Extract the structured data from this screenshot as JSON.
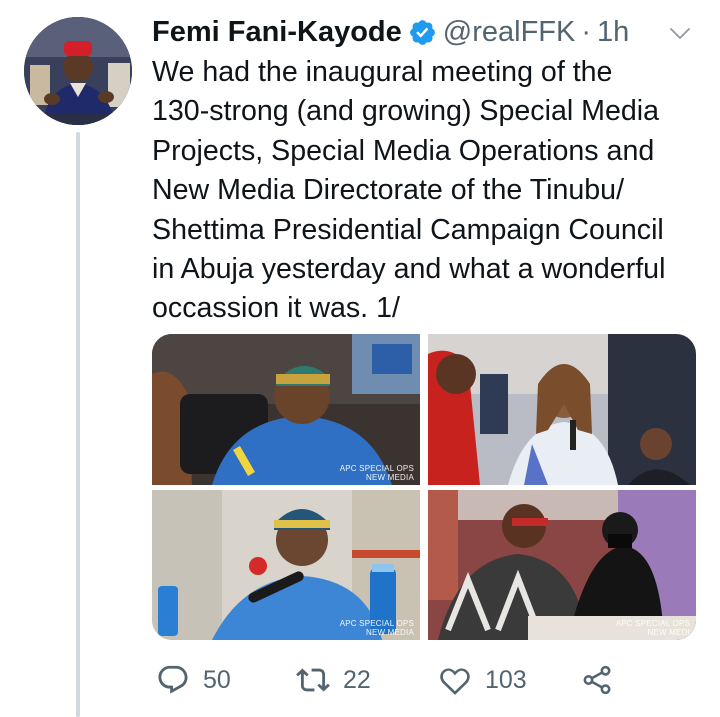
{
  "author": {
    "name": "Femi Fani-Kayode",
    "handle": "@realFFK",
    "separator": "·",
    "time": "1h"
  },
  "tweet": {
    "lines": [
      "We had the inaugural meeting of the",
      "130-strong (and growing) Special Media",
      "Projects, Special Media Operations and",
      "New Media Directorate of the Tinubu/",
      "Shettima Presidential Campaign Council",
      "in Abuja yesterday and what a wonderful",
      "occassion it was. 1/"
    ]
  },
  "media": {
    "watermark_line1": "APC SPECIAL OPS",
    "watermark_line2": "NEW MEDIA",
    "watermark_line2_cropped": "NEW MEDI"
  },
  "actions": {
    "replies": "50",
    "retweets": "22",
    "likes": "103"
  },
  "icons": {
    "verified": "verified-badge-icon",
    "more": "chevron-down-icon",
    "reply": "reply-icon",
    "retweet": "retweet-icon",
    "like": "heart-icon",
    "share": "share-icon"
  },
  "colors": {
    "verified": "#1d9bf0",
    "text": "#0f1419",
    "secondary": "#536471",
    "thread_line": "#cfd9de"
  }
}
